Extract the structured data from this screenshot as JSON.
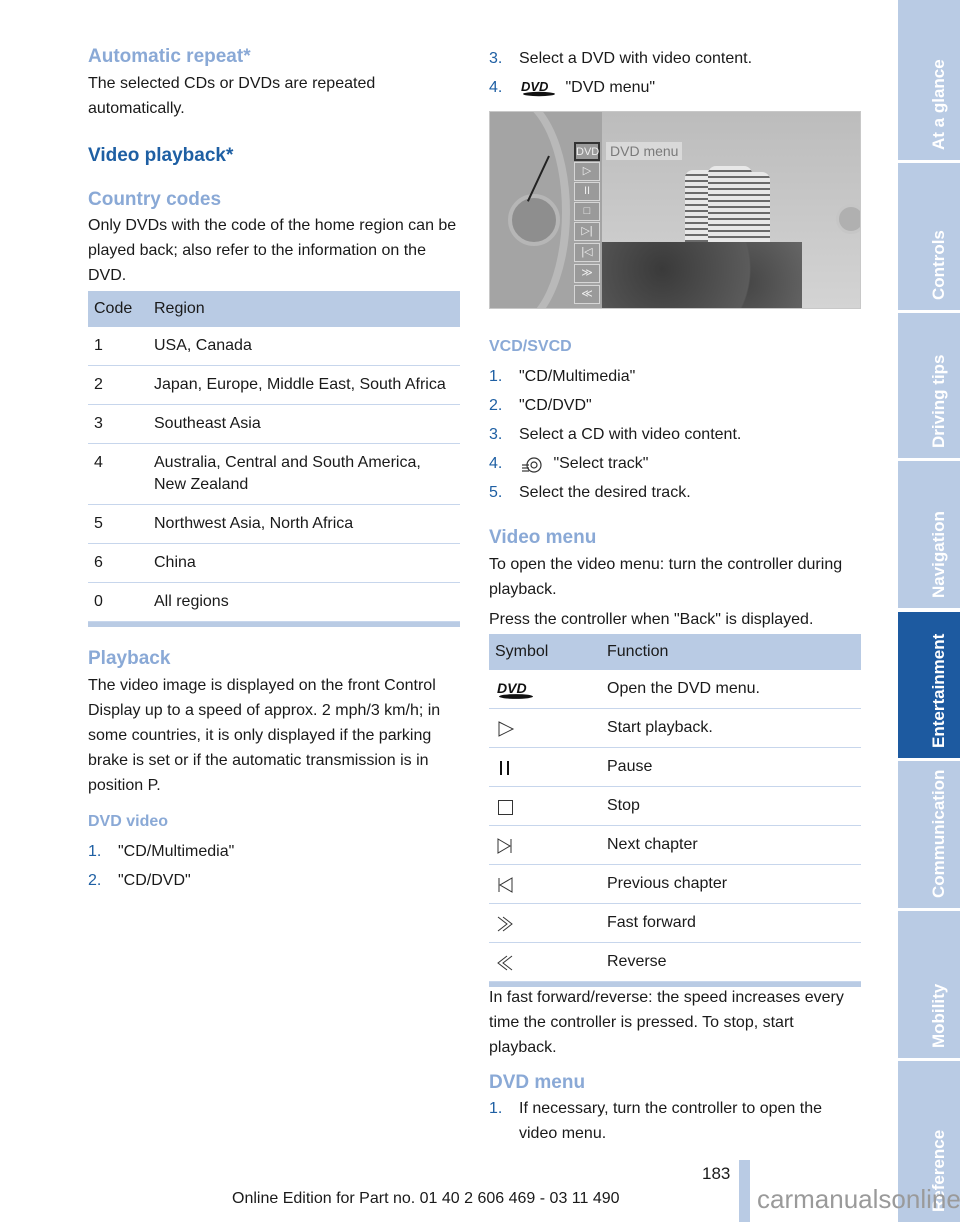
{
  "left": {
    "auto_repeat": {
      "heading": "Automatic repeat*",
      "body": "The selected CDs or DVDs are repeated automatically."
    },
    "video_playback": {
      "heading": "Video playback*"
    },
    "country_codes": {
      "heading": "Country codes",
      "body": "Only DVDs with the code of the home region can be played back; also refer to the information on the DVD.",
      "table": {
        "headers": [
          "Code",
          "Region"
        ],
        "rows": [
          {
            "code": "1",
            "region": "USA, Canada"
          },
          {
            "code": "2",
            "region": "Japan, Europe, Middle East, South Africa"
          },
          {
            "code": "3",
            "region": "Southeast Asia"
          },
          {
            "code": "4",
            "region": "Australia, Central and South America, New Zealand"
          },
          {
            "code": "5",
            "region": "Northwest Asia, North Africa"
          },
          {
            "code": "6",
            "region": "China"
          },
          {
            "code": "0",
            "region": "All regions"
          }
        ]
      }
    },
    "playback": {
      "heading": "Playback",
      "body": "The video image is displayed on the front Control Display up to a speed of approx. 2 mph/3 km/h; in some countries, it is only displayed if the parking brake is set or if the automatic transmission is in position P."
    },
    "dvd_video": {
      "heading": "DVD video",
      "steps": [
        {
          "num": "1.",
          "text": "\"CD/Multimedia\""
        },
        {
          "num": "2.",
          "text": "\"CD/DVD\""
        }
      ]
    }
  },
  "right": {
    "dvd_steps": [
      {
        "num": "3.",
        "text": "Select a DVD with video content."
      },
      {
        "num": "4.",
        "icon": "dvd-icon",
        "text": "\"DVD menu\""
      }
    ],
    "figure": {
      "menu_label": "DVD menu",
      "buttons": [
        "DVD",
        "▷",
        "II",
        "□",
        "▷|",
        "|◁",
        "≫",
        "≪"
      ]
    },
    "vcd": {
      "heading": "VCD/SVCD",
      "steps": [
        {
          "num": "1.",
          "text": "\"CD/Multimedia\""
        },
        {
          "num": "2.",
          "text": "\"CD/DVD\""
        },
        {
          "num": "3.",
          "text": "Select a CD with video content."
        },
        {
          "num": "4.",
          "icon": "select-track-icon",
          "text": "\"Select track\""
        },
        {
          "num": "5.",
          "text": "Select the desired track."
        }
      ]
    },
    "video_menu": {
      "heading": "Video menu",
      "body1": "To open the video menu: turn the controller during playback.",
      "body2": "Press the controller when \"Back\" is displayed.",
      "table": {
        "headers": [
          "Symbol",
          "Function"
        ],
        "rows": [
          {
            "symbol": "dvd-icon",
            "function": "Open the DVD menu."
          },
          {
            "symbol": "play-icon",
            "function": "Start playback."
          },
          {
            "symbol": "pause-icon",
            "function": "Pause"
          },
          {
            "symbol": "stop-icon",
            "function": "Stop"
          },
          {
            "symbol": "next-chapter-icon",
            "function": "Next chapter"
          },
          {
            "symbol": "previous-chapter-icon",
            "function": "Previous chapter"
          },
          {
            "symbol": "fast-forward-icon",
            "function": "Fast forward"
          },
          {
            "symbol": "reverse-icon",
            "function": "Reverse"
          }
        ]
      },
      "after": "In fast forward/reverse: the speed increases every time the controller is pressed. To stop, start playback."
    },
    "dvd_menu": {
      "heading": "DVD menu",
      "steps": [
        {
          "num": "1.",
          "text": "If necessary, turn the controller to open the video menu."
        }
      ]
    }
  },
  "sidebar": {
    "tabs": [
      {
        "label": "At a glance",
        "active": false
      },
      {
        "label": "Controls",
        "active": false
      },
      {
        "label": "Driving tips",
        "active": false
      },
      {
        "label": "Navigation",
        "active": false
      },
      {
        "label": "Entertainment",
        "active": true
      },
      {
        "label": "Communication",
        "active": false
      },
      {
        "label": "Mobility",
        "active": false
      },
      {
        "label": "Reference",
        "active": false
      }
    ]
  },
  "footer": {
    "page_number": "183",
    "edition": "Online Edition for Part no. 01 40 2 606 469 - 03 11 490",
    "watermark": "carmanualsonline.info"
  },
  "colors": {
    "heading_light": "#8aa9d6",
    "heading_dark": "#1e5fa3",
    "table_header": "#b9cbe4",
    "active_tab": "#1d5aa0"
  }
}
